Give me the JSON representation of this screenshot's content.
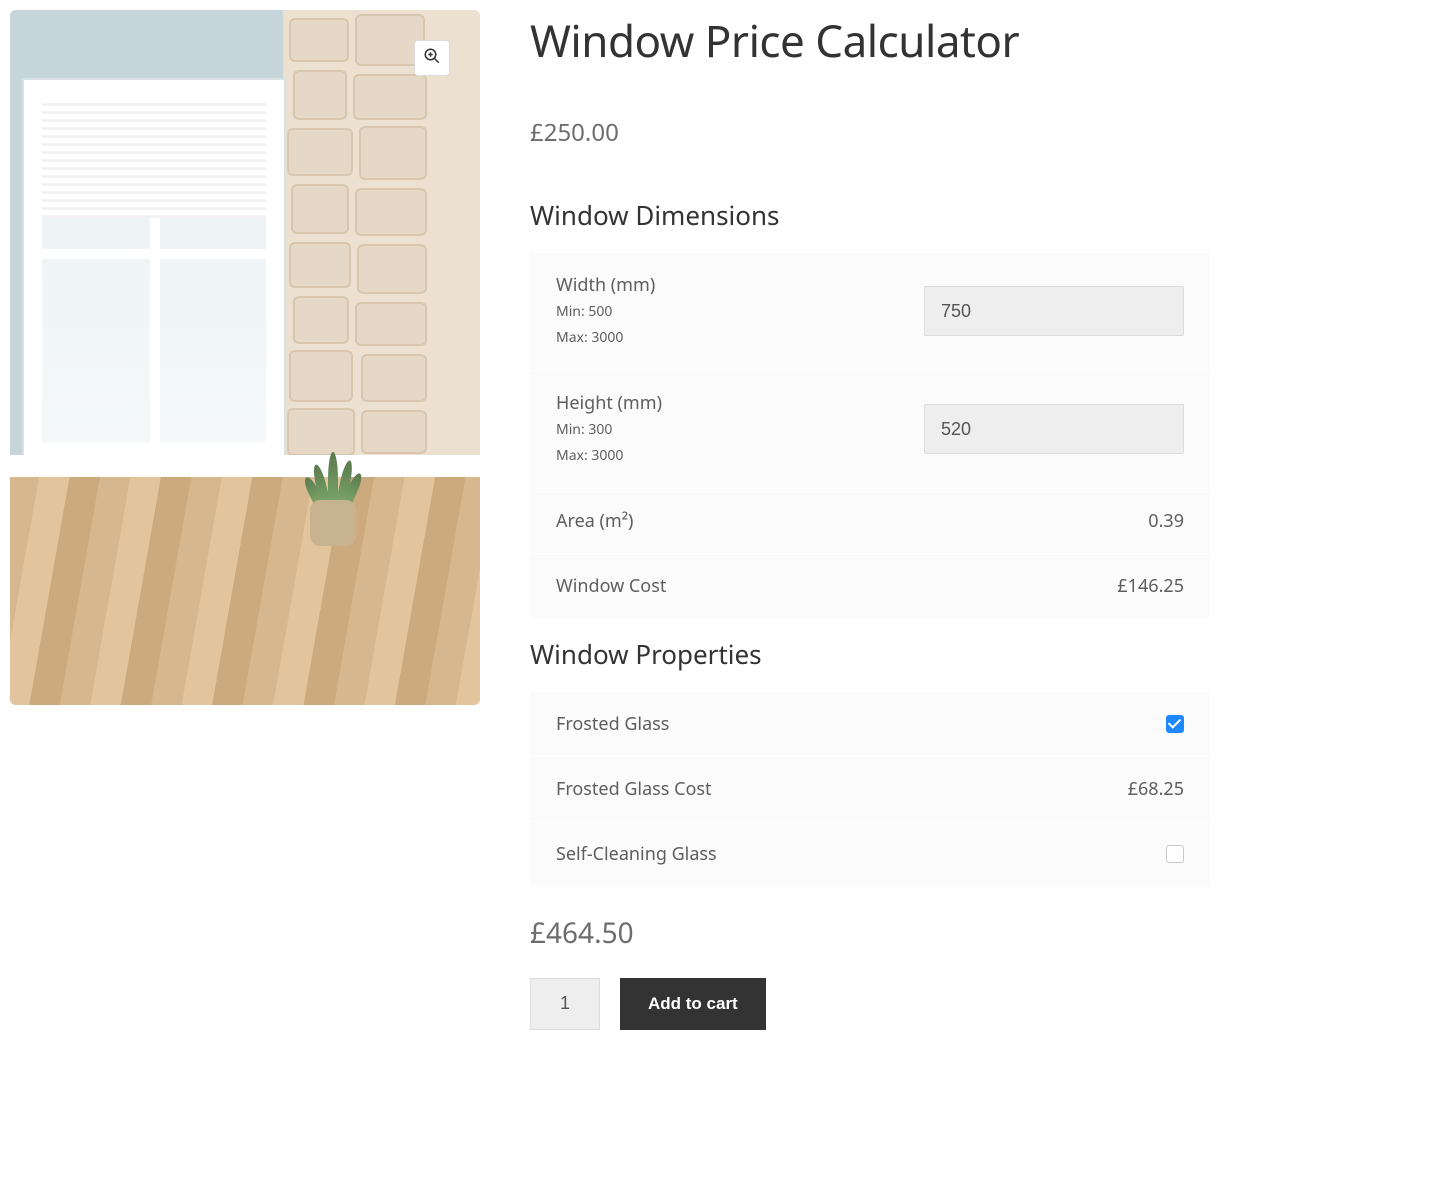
{
  "product": {
    "title": "Window Price Calculator",
    "base_price": "£250.00",
    "total_price": "£464.50",
    "quantity": "1",
    "add_to_cart_label": "Add to cart"
  },
  "dimensions": {
    "heading": "Window Dimensions",
    "width": {
      "label": "Width (mm)",
      "min_label": "Min: 500",
      "max_label": "Max: 3000",
      "value": "750"
    },
    "height": {
      "label": "Height (mm)",
      "min_label": "Min: 300",
      "max_label": "Max: 3000",
      "value": "520"
    },
    "area": {
      "label": "Area (m²)",
      "value": "0.39"
    },
    "window_cost": {
      "label": "Window Cost",
      "value": "£146.25"
    }
  },
  "properties": {
    "heading": "Window Properties",
    "frosted_glass": {
      "label": "Frosted Glass",
      "checked": true
    },
    "frosted_glass_cost": {
      "label": "Frosted Glass Cost",
      "value": "£68.25"
    },
    "self_cleaning_glass": {
      "label": "Self-Cleaning Glass",
      "checked": false
    }
  }
}
